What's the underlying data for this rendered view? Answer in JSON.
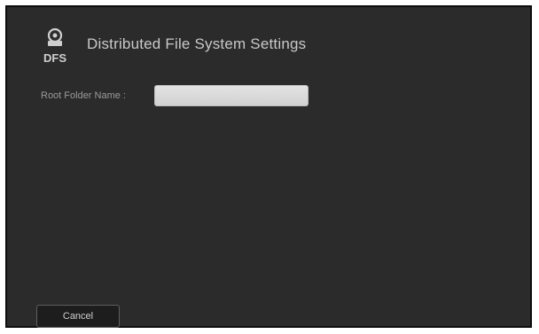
{
  "dialog": {
    "title": "Distributed File System Settings",
    "icon": "dfs-icon",
    "icon_text": "DFS"
  },
  "form": {
    "root_folder_label": "Root Folder Name :",
    "root_folder_value": ""
  },
  "footer": {
    "cancel_label": "Cancel"
  },
  "colors": {
    "background": "#2b2b2b",
    "title_text": "#c9c9c9",
    "input_bg": "#d9d9d9"
  }
}
